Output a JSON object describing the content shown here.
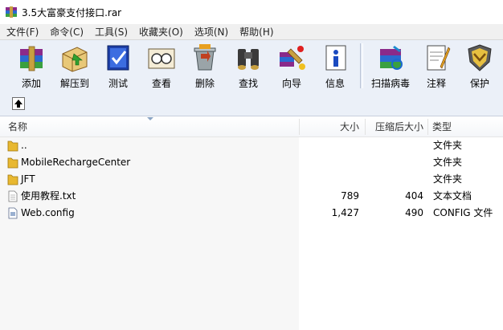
{
  "window": {
    "title": "3.5大富豪支付接口.rar"
  },
  "menu": [
    "文件(F)",
    "命令(C)",
    "工具(S)",
    "收藏夹(O)",
    "选项(N)",
    "帮助(H)"
  ],
  "toolbar": {
    "add": "添加",
    "extract": "解压到",
    "test": "测试",
    "view": "查看",
    "delete": "删除",
    "find": "查找",
    "wizard": "向导",
    "info": "信息",
    "scan": "扫描病毒",
    "comment": "注释",
    "protect": "保护"
  },
  "columns": {
    "name": "名称",
    "size": "大小",
    "packed": "压缩后大小",
    "type": "类型"
  },
  "files": [
    {
      "name": "..",
      "size": "",
      "packed": "",
      "type": "文件夹",
      "icon": "folder-icon"
    },
    {
      "name": "MobileRechargeCenter",
      "size": "",
      "packed": "",
      "type": "文件夹",
      "icon": "folder-icon"
    },
    {
      "name": "JFT",
      "size": "",
      "packed": "",
      "type": "文件夹",
      "icon": "folder-icon"
    },
    {
      "name": "使用教程.txt",
      "size": "789",
      "packed": "404",
      "type": "文本文档",
      "icon": "text-file-icon"
    },
    {
      "name": "Web.config",
      "size": "1,427",
      "packed": "490",
      "type": "CONFIG 文件",
      "icon": "config-file-icon"
    }
  ]
}
